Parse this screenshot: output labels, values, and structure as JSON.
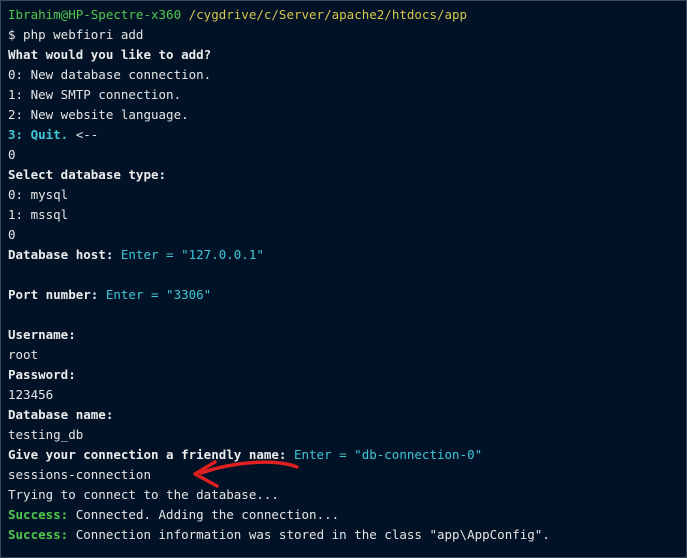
{
  "prompt": {
    "user": "Ibrahim@HP-Spectre-x360",
    "path": "/cygdrive/c/Server/apache2/htdocs/app",
    "command": "$ php webfiori add"
  },
  "menu": {
    "question": "What would you like to add?",
    "options": [
      "0: New database connection.",
      "1: New SMTP connection.",
      "2: New website language."
    ],
    "quit_label": "3: Quit.",
    "quit_marker": " <--",
    "answer": "0"
  },
  "db_type": {
    "question": "Select database type:",
    "options": [
      "0: mysql",
      "1: mssql"
    ],
    "answer": "0"
  },
  "host": {
    "label": "Database host:",
    "hint": " Enter = \"127.0.0.1\""
  },
  "port": {
    "label": "Port number:",
    "hint": " Enter = \"3306\""
  },
  "username": {
    "label": "Username:",
    "value": "root"
  },
  "password": {
    "label": "Password:",
    "value": "123456"
  },
  "dbname": {
    "label": "Database name:",
    "value": "testing_db"
  },
  "friendly_name": {
    "label": "Give your connection a friendly name:",
    "hint": " Enter = \"db-connection-0\"",
    "value": "sessions-connection"
  },
  "output": {
    "trying": "Trying to connect to the database...",
    "success1_label": "Success:",
    "success1_text": " Connected. Adding the connection...",
    "success2_label": "Success:",
    "success2_text": " Connection information was stored in the class \"app\\AppConfig\"."
  },
  "colors": {
    "background": "#001226",
    "prompt_user": "#4ec94e",
    "prompt_path": "#d9c54a",
    "hint": "#3cc8d8",
    "success": "#4ec94e",
    "annotation_arrow": "#e02020"
  }
}
